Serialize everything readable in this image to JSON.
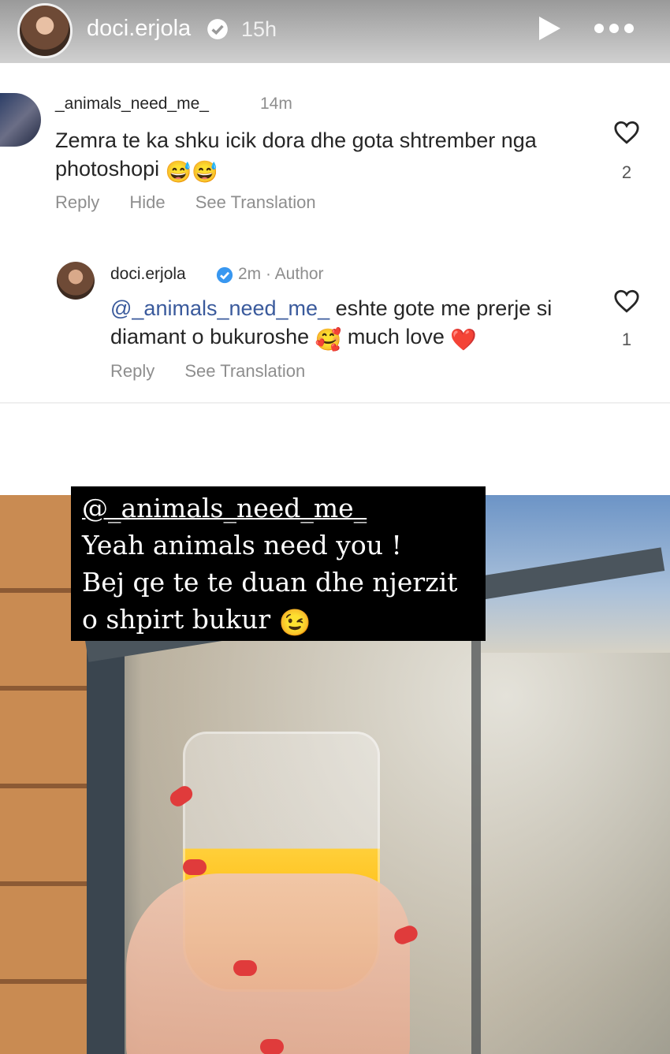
{
  "story_header": {
    "username": "doci.erjola",
    "time": "15h"
  },
  "comments": [
    {
      "username": "_animals_need_me_",
      "time": "14m",
      "text": "Zemra te ka shku icik dora dhe gota shtrember nga photoshopi",
      "emoji": "😅😅",
      "like_count": "2",
      "actions": [
        "Reply",
        "Hide",
        "See Translation"
      ]
    },
    {
      "username": "doci.erjola",
      "meta": "2m · Author",
      "mention": "@_animals_need_me_",
      "text_part1": " eshte gote me prerje si diamant o bukuroshe",
      "emoji1": "🥰",
      "text_part2": " much love",
      "emoji2": "❤️",
      "like_count": "1",
      "actions": [
        "Reply",
        "See Translation"
      ]
    }
  ],
  "story_caption": {
    "mention": "@_animals_need_me_",
    "line1": "Yeah animals need you !",
    "line2": "Bej qe te te duan dhe njerzit",
    "line3": "o shpirt bukur",
    "emoji": "😉"
  },
  "icons": [
    "verified-badge-icon",
    "play-icon",
    "more-icon",
    "heart-icon"
  ],
  "colors": {
    "verified": "#3897f0",
    "mention": "#3a5a9c",
    "muted": "#8e8e8e",
    "caption_bg": "#000000"
  }
}
